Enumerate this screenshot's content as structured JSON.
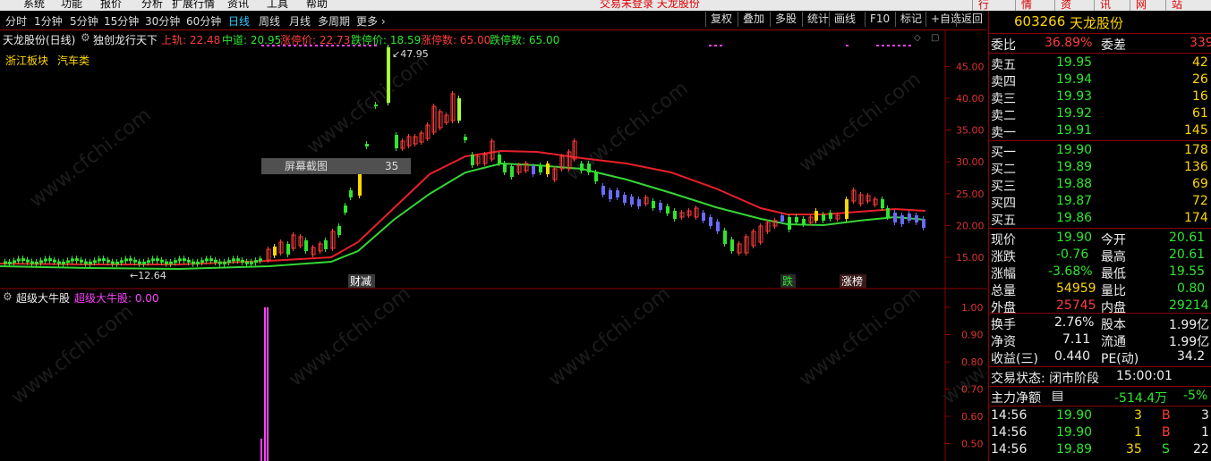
{
  "menu": {
    "items": [
      "系统",
      "功能",
      "报价",
      "分析",
      "扩展行情",
      "资讯",
      "工具",
      "帮助"
    ],
    "status": "交易未登录  天龙股份",
    "right_buttons": [
      "行",
      "情",
      "资",
      "讯",
      "网",
      "站"
    ]
  },
  "toolbar": {
    "periods": [
      "分时",
      "1分钟",
      "5分钟",
      "15分钟",
      "30分钟",
      "60分钟",
      "日线",
      "周线",
      "月线",
      "多周期",
      "更多 ›"
    ],
    "active_period": "日线",
    "actions": [
      "复权",
      "叠加",
      "多股",
      "统计",
      "画线",
      "F10",
      "标记",
      "+自选",
      "返回"
    ]
  },
  "main_chart": {
    "stock_label": "天龙股份(日线)",
    "indicator_name": "独创龙行天下",
    "upper_label": "上轨: 22.48",
    "mid_label": "中道: 20.95",
    "limit_up_price": "涨停价: 22.73",
    "limit_down_price": "跌停价: 18.59",
    "limit_up_count": "涨停数: 65.00",
    "limit_down_count": "跌停数: 65.00",
    "sector": "浙江板块",
    "industry": "汽车类",
    "high_mark": "47.95",
    "low_mark": "12.64",
    "screenshot_label": "屏幕截图",
    "screenshot_value": "35",
    "signals": [
      "财减",
      "跌",
      "涨榜"
    ],
    "y_ticks": [
      "45.00",
      "40.00",
      "35.00",
      "30.00",
      "25.00",
      "20.00",
      "15.00"
    ],
    "watermark": "www.cfchi.com"
  },
  "sub_chart": {
    "name": "超级大牛股",
    "value_label": "超级大牛股: 0.00",
    "y_ticks": [
      "1.00",
      "0.90",
      "0.80",
      "0.70",
      "0.60",
      "0.50"
    ]
  },
  "colors": {
    "up": "#ff3c3c",
    "down": "#2fe52f",
    "upper_band": "#e8202a",
    "mid_band": "#35d635",
    "signal": "#ff40ff",
    "accent": "#37c8ff"
  },
  "quote": {
    "code": "603266",
    "name": "天龙股份",
    "weibi_label": "委比",
    "weibi_value": "36.89%",
    "weicha_label": "委差",
    "weicha_value": "339",
    "asks": [
      {
        "label": "卖五",
        "price": "19.95",
        "vol": "42"
      },
      {
        "label": "卖四",
        "price": "19.94",
        "vol": "26"
      },
      {
        "label": "卖三",
        "price": "19.93",
        "vol": "16"
      },
      {
        "label": "卖二",
        "price": "19.92",
        "vol": "61"
      },
      {
        "label": "卖一",
        "price": "19.91",
        "vol": "145"
      }
    ],
    "bids": [
      {
        "label": "买一",
        "price": "19.90",
        "vol": "178"
      },
      {
        "label": "买二",
        "price": "19.89",
        "vol": "136"
      },
      {
        "label": "买三",
        "price": "19.88",
        "vol": "69"
      },
      {
        "label": "买四",
        "price": "19.87",
        "vol": "72"
      },
      {
        "label": "买五",
        "price": "19.86",
        "vol": "174"
      }
    ],
    "stats": [
      {
        "l1": "现价",
        "v1": "19.90",
        "c1": "green",
        "l2": "今开",
        "v2": "20.61",
        "c2": "green"
      },
      {
        "l1": "涨跌",
        "v1": "-0.76",
        "c1": "green",
        "l2": "最高",
        "v2": "20.61",
        "c2": "green"
      },
      {
        "l1": "涨幅",
        "v1": "-3.68%",
        "c1": "green",
        "l2": "最低",
        "v2": "19.55",
        "c2": "green"
      },
      {
        "l1": "总量",
        "v1": "54959",
        "c1": "yellow",
        "l2": "量比",
        "v2": "0.80",
        "c2": "green"
      },
      {
        "l1": "外盘",
        "v1": "25745",
        "c1": "red",
        "l2": "内盘",
        "v2": "29214",
        "c2": "green"
      }
    ],
    "stats2": [
      {
        "l1": "换手",
        "v1": "2.76%",
        "l2": "股本",
        "v2": "1.99亿"
      },
      {
        "l1": "净资",
        "v1": "7.11",
        "l2": "流通",
        "v2": "1.99亿"
      },
      {
        "l1": "收益(三)",
        "v1": "0.440",
        "l2": "PE(动)",
        "v2": "34.2"
      }
    ],
    "trade_state_label": "交易状态: 闭市阶段",
    "trade_state_time": "15:00:01",
    "main_net_label": "主力净额",
    "main_net_value": "-514.4万",
    "main_net_pct": "-5%",
    "ticks": [
      {
        "time": "14:56",
        "price": "19.90",
        "vol": "3",
        "side": "B",
        "n": "3"
      },
      {
        "time": "14:56",
        "price": "19.90",
        "vol": "1",
        "side": "B",
        "n": "1"
      },
      {
        "time": "14:56",
        "price": "19.89",
        "vol": "35",
        "side": "S",
        "n": "22"
      }
    ]
  }
}
